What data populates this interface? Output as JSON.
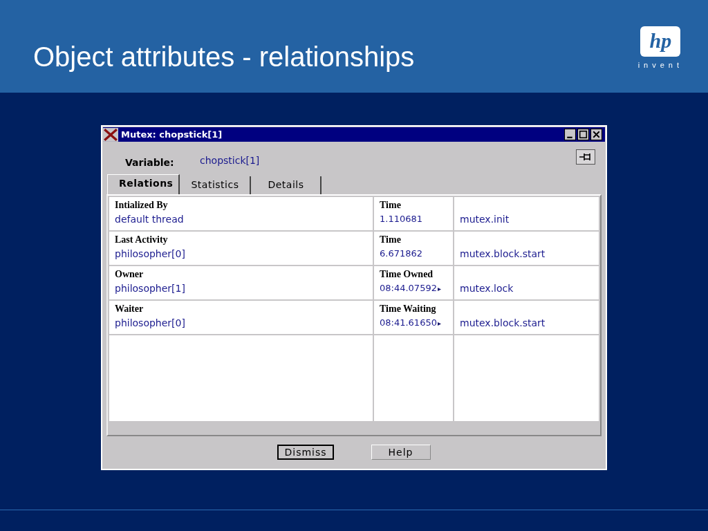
{
  "slide": {
    "title": "Object attributes - relationships",
    "logo": {
      "mark": "hp",
      "tagline": "invent"
    }
  },
  "window": {
    "title": "Mutex: chopstick[1]",
    "variable": {
      "label": "Variable:",
      "value": "chopstick[1]"
    },
    "tabs": [
      {
        "label": "Relations",
        "selected": true
      },
      {
        "label": "Statistics",
        "selected": false
      },
      {
        "label": "Details",
        "selected": false
      }
    ],
    "rows": [
      {
        "label": "Intialized By",
        "value": "default thread",
        "time_label": "Time",
        "time": "1.110681",
        "time_truncated": false,
        "event": "mutex.init"
      },
      {
        "label": "Last Activity",
        "value": "philosopher[0]",
        "time_label": "Time",
        "time": "6.671862",
        "time_truncated": false,
        "event": "mutex.block.start"
      },
      {
        "label": "Owner",
        "value": "philosopher[1]",
        "time_label": "Time Owned",
        "time": "08:44.07592",
        "time_truncated": true,
        "event": "mutex.lock"
      },
      {
        "label": "Waiter",
        "value": "philosopher[0]",
        "time_label": "Time Waiting",
        "time": "08:41.61650",
        "time_truncated": true,
        "event": "mutex.block.start"
      }
    ],
    "buttons": [
      {
        "label": "Dismiss",
        "default": true
      },
      {
        "label": "Help",
        "default": false
      }
    ]
  }
}
